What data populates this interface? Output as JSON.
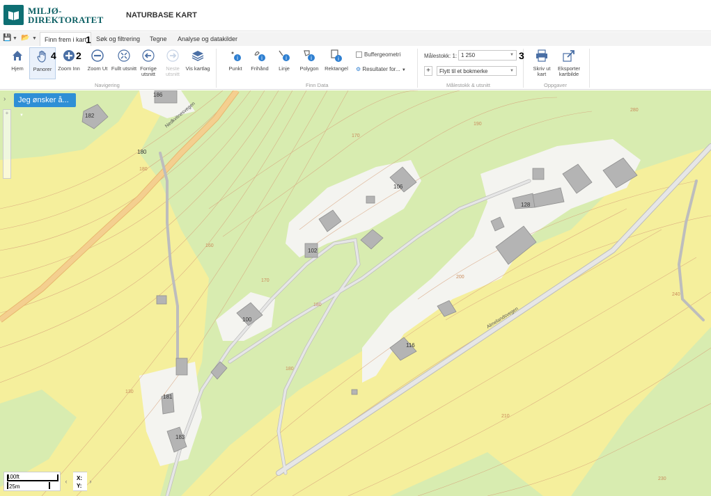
{
  "header": {
    "logo_line1": "MILJØ-",
    "logo_line2": "DIREKTORATET",
    "app_title": "NATURBASE KART"
  },
  "tabs": [
    {
      "label": "Finn frem i kart",
      "active": true
    },
    {
      "label": "Søk og filtrering"
    },
    {
      "label": "Tegne"
    },
    {
      "label": "Analyse og datakilder"
    }
  ],
  "annotations": {
    "a1": "1",
    "a2": "2",
    "a3": "3",
    "a4": "4"
  },
  "ribbon": {
    "navigation": {
      "label": "Navigering",
      "tools": [
        {
          "label": "Hjem",
          "icon": "home-icon"
        },
        {
          "label": "Panorer",
          "icon": "hand-icon",
          "active": true
        },
        {
          "label": "Zoom Inn",
          "icon": "zoom-in-icon"
        },
        {
          "label": "Zoom Ut",
          "icon": "zoom-out-icon"
        },
        {
          "label": "Fullt utsnitt",
          "icon": "full-extent-icon"
        },
        {
          "label": "Forrige utsnitt",
          "icon": "back-icon"
        },
        {
          "label": "Neste utsnitt",
          "icon": "forward-icon",
          "disabled": true
        },
        {
          "label": "Vis kartlag",
          "icon": "layers-icon"
        }
      ]
    },
    "finn_data": {
      "label": "Finn Data",
      "tools": [
        {
          "label": "Punkt",
          "icon": "point-info-icon"
        },
        {
          "label": "Frihånd",
          "icon": "freehand-info-icon"
        },
        {
          "label": "Linje",
          "icon": "line-info-icon"
        },
        {
          "label": "Polygon",
          "icon": "polygon-info-icon"
        },
        {
          "label": "Rektangel",
          "icon": "rectangle-info-icon"
        }
      ],
      "buffer_label": "Buffergeometri",
      "results_label": "Resultater for..."
    },
    "scale": {
      "label": "Målestokk & utsnitt",
      "scale_prefix": "Målestokk: 1:",
      "scale_value": "1 250",
      "bookmark_label": "Flytt til et bokmerke"
    },
    "tasks": {
      "label": "Oppgaver",
      "tools": [
        {
          "label": "Skriv ut kart",
          "icon": "print-icon"
        },
        {
          "label": "Eksporter kartbilde",
          "icon": "export-icon"
        }
      ]
    }
  },
  "map": {
    "jeg_onsker": "Jeg ønsker å...",
    "roads": [
      "Nedkvitnesvegen",
      "Almelandsvegen"
    ],
    "address_labels": [
      "186",
      "182",
      "180",
      "106",
      "128",
      "102",
      "100",
      "116",
      "181",
      "183"
    ],
    "scale_bar": {
      "ft": "100ft",
      "m": "25m"
    },
    "coords": {
      "x_label": "X:",
      "y_label": "Y:"
    }
  },
  "colors": {
    "map_yellow": "#f5ef9c",
    "forest_green": "#d8ecb0",
    "road_orange": "#f4cf8f",
    "contour": "#d6a07a",
    "building": "#b4b4b4",
    "accent_blue": "#2e8fd6"
  }
}
